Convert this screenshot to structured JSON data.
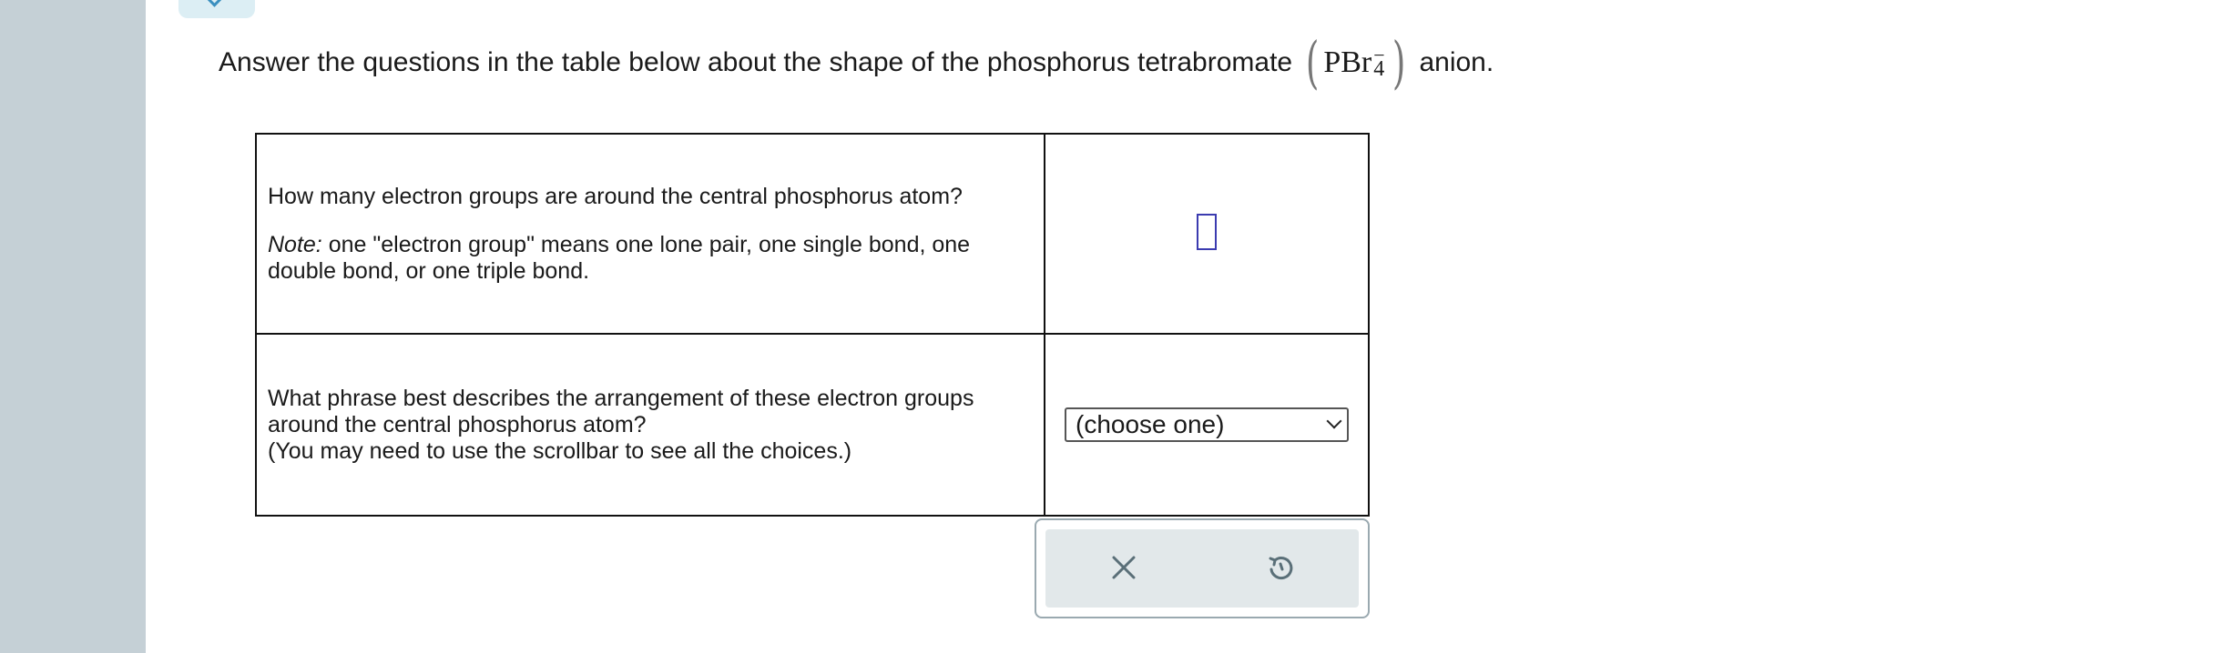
{
  "question": {
    "text_before": "Answer the questions in the table below about the shape of the phosphorus tetrabromate",
    "formula_base": "PBr",
    "formula_subscript": "4",
    "formula_charge": "−",
    "text_after": "anion."
  },
  "table": {
    "row1": {
      "question_line": "How many electron groups are around the central phosphorus atom?",
      "note_label": "Note:",
      "note_text": " one \"electron group\" means one lone pair, one single bond, one double bond, or one triple bond.",
      "answer_value": ""
    },
    "row2": {
      "question_line1": "What phrase best describes the arrangement of these electron groups around the central phosphorus atom?",
      "question_line2": "(You may need to use the scrollbar to see all the choices.)",
      "select_value": "(choose one)"
    }
  },
  "actions": {
    "clear_icon": "x-icon",
    "undo_icon": "undo-icon"
  },
  "colors": {
    "sidebar": "#c5d0d6",
    "accent_input": "#3b3bb0",
    "action_panel": "#e2e8ea",
    "icon": "#5a6f78"
  }
}
